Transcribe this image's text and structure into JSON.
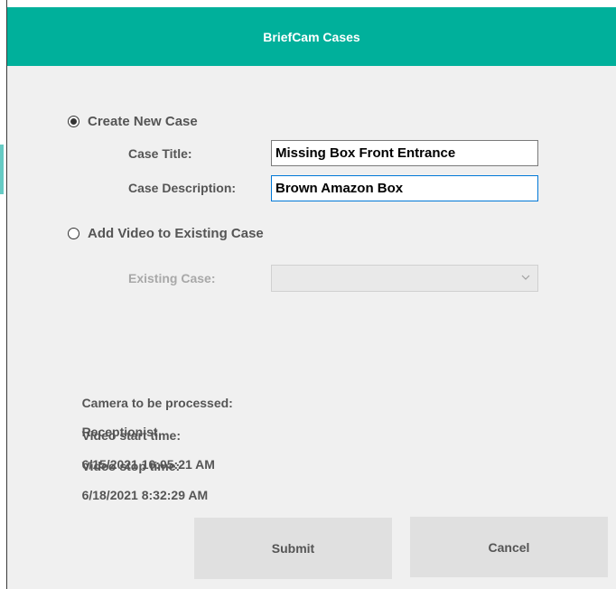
{
  "dialog": {
    "title": "BriefCam Cases"
  },
  "create_new": {
    "label": "Create New Case",
    "selected": true,
    "case_title_label": "Case Title:",
    "case_title_value": "Missing Box Front Entrance",
    "case_description_label": "Case Description:",
    "case_description_value": "Brown Amazon Box"
  },
  "add_existing": {
    "label": "Add Video to Existing Case",
    "selected": false,
    "existing_case_label": "Existing Case:",
    "existing_case_value": ""
  },
  "info": {
    "camera_label": "Camera to be processed:",
    "camera_value": "Receptionist",
    "start_label": "Video start time:",
    "start_value": "6/15/2021 10:05:21 AM",
    "stop_label": "Video stop time:",
    "stop_value": "6/18/2021 8:32:29 AM"
  },
  "buttons": {
    "submit": "Submit",
    "cancel": "Cancel"
  },
  "colors": {
    "header": "#00b09b",
    "focus_border": "#0078d7"
  },
  "icons": {
    "dropdown": "chevron-down-icon"
  }
}
